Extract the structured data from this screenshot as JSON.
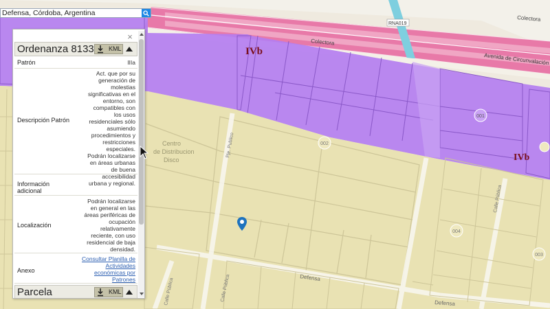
{
  "search": {
    "value": "Defensa, Córdoba, Argentina"
  },
  "map": {
    "zone_labels": [
      "IVb",
      "IVb"
    ],
    "street_labels": [
      "Colectora",
      "Colectora",
      "Avenida de Circunvalación Agust",
      "RNA019",
      "Defensa",
      "Defensa",
      "Calle Pública",
      "Calle Pública",
      "Pje. Publico",
      "Calle Pública"
    ],
    "parcel_labels": [
      "Centro",
      "de Distribucion",
      "Disco"
    ],
    "parcel_numbers": [
      "001",
      "002",
      "004",
      "003"
    ],
    "colors": {
      "zone_purple": "#b47ef0",
      "zone_yellow": "#e8e2b0",
      "highway_pink": "#e879a8",
      "water": "#7ecfdf"
    }
  },
  "panel": {
    "close_glyph": "×",
    "header1": {
      "title": "Ordenanza 8133",
      "kml_label": "KML"
    },
    "rows": [
      {
        "label": "Patrón",
        "value": "IIIa"
      },
      {
        "label": "Descripción Patrón",
        "value": "Act. que por su generación de molestias significativas en el entorno, son compatibles con los usos residenciales sólo asumiendo procedimientos y restricciones especiales. Podrán localizarse en áreas urbanas de buena accesibilidad urbana y regional."
      },
      {
        "label": "Información adicional",
        "value": ""
      },
      {
        "label": "Localización",
        "value": "Podrán localizarse en general en las áreas periféricas de ocupación relativamente reciente, con uso residencial de baja densidad."
      },
      {
        "label": "Anexo",
        "value": "Consultar Planilla de Actividades económicas por Patrones"
      }
    ],
    "header2": {
      "title": "Parcela",
      "kml_label": "KML"
    }
  }
}
